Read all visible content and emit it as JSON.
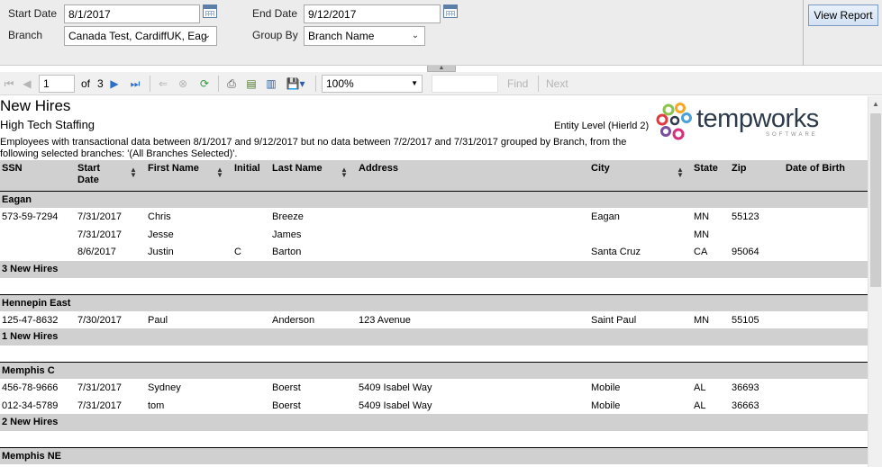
{
  "params": {
    "start_date_label": "Start Date",
    "start_date_value": "8/1/2017",
    "end_date_label": "End Date",
    "end_date_value": "9/12/2017",
    "branch_label": "Branch",
    "branch_value": "Canada Test, CardiffUK, Eag",
    "group_by_label": "Group By",
    "group_by_value": "Branch Name",
    "view_report_label": "View Report"
  },
  "toolbar": {
    "page_current": "1",
    "page_of": "of",
    "page_total": "3",
    "zoom": "100%",
    "find_label": "Find",
    "next_label": "Next"
  },
  "report": {
    "title": "New Hires",
    "company": "High Tech Staffing",
    "entity_level": "Entity Level (Hierld 2)",
    "description": "Employees with transactional data between 8/1/2017 and 9/12/2017 but no data between 7/2/2017 and 7/31/2017 grouped by Branch, from the following selected branches: '(All Branches Selected)'.",
    "logo_text": "tempworks",
    "logo_sub": "SOFTWARE",
    "columns": {
      "ssn": "SSN",
      "start_date": "Start Date",
      "first_name": "First Name",
      "initial": "Initial",
      "last_name": "Last Name",
      "address": "Address",
      "city": "City",
      "state": "State",
      "zip": "Zip",
      "dob": "Date of Birth"
    },
    "groups": [
      {
        "name": "Eagan",
        "rows": [
          {
            "ssn": "573-59-7294",
            "start": "7/31/2017",
            "first": "Chris",
            "initial": "",
            "last": "Breeze",
            "address": "",
            "city": "Eagan",
            "state": "MN",
            "zip": "55123",
            "dob": ""
          },
          {
            "ssn": "",
            "start": "7/31/2017",
            "first": "Jesse",
            "initial": "",
            "last": "James",
            "address": "",
            "city": "",
            "state": "MN",
            "zip": "",
            "dob": ""
          },
          {
            "ssn": "",
            "start": "8/6/2017",
            "first": "Justin",
            "initial": "C",
            "last": "Barton",
            "address": "",
            "city": "Santa Cruz",
            "state": "CA",
            "zip": "95064",
            "dob": ""
          }
        ],
        "total": "3 New Hires"
      },
      {
        "name": "Hennepin East",
        "rows": [
          {
            "ssn": "125-47-8632",
            "start": "7/30/2017",
            "first": "Paul",
            "initial": "",
            "last": "Anderson",
            "address": "123 Avenue",
            "city": "Saint Paul",
            "state": "MN",
            "zip": "55105",
            "dob": ""
          }
        ],
        "total": "1 New Hires"
      },
      {
        "name": "Memphis C",
        "rows": [
          {
            "ssn": "456-78-9666",
            "start": "7/31/2017",
            "first": "Sydney",
            "initial": "",
            "last": "Boerst",
            "address": "5409 Isabel Way",
            "city": "Mobile",
            "state": "AL",
            "zip": "36693",
            "dob": ""
          },
          {
            "ssn": "012-34-5789",
            "start": "7/31/2017",
            "first": "tom",
            "initial": "",
            "last": "Boerst",
            "address": "5409 Isabel Way",
            "city": "Mobile",
            "state": "AL",
            "zip": "36663",
            "dob": ""
          }
        ],
        "total": "2 New Hires"
      },
      {
        "name": "Memphis NE",
        "rows": [],
        "total": ""
      }
    ]
  }
}
